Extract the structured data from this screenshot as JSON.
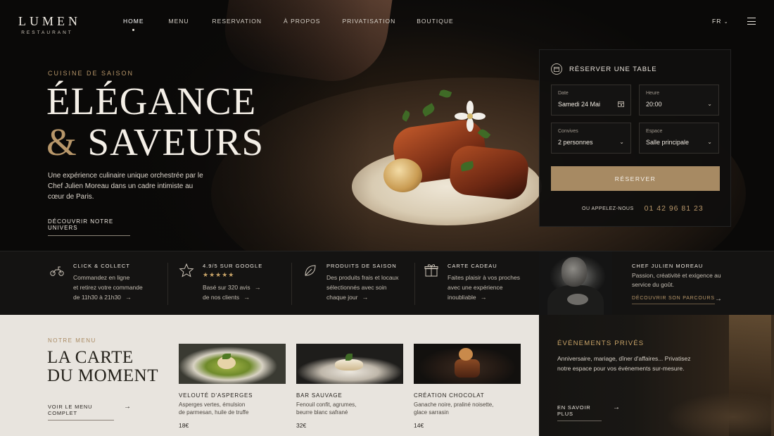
{
  "brand": {
    "name": "LUMEN",
    "tagline": "RESTAURANT"
  },
  "nav": {
    "items": [
      {
        "label": "HOME"
      },
      {
        "label": "MENU"
      },
      {
        "label": "RESERVATION"
      },
      {
        "label": "À PROPOS"
      },
      {
        "label": "PRIVATISATION"
      },
      {
        "label": "BOUTIQUE"
      }
    ],
    "active_index": 0,
    "lang": "FR"
  },
  "hero": {
    "kicker": "CUISINE DE SAISON",
    "title_line1": "ÉLÉGANCE",
    "title_amp": "&",
    "title_line2": "SAVEURS",
    "lead": "Une expérience culinaire unique orchestrée par le Chef Julien Moreau dans un cadre intimiste au cœur de Paris.",
    "cta": "DÉCOUVRIR NOTRE UNIVERS"
  },
  "reservation": {
    "title": "RÉSERVER UNE TABLE",
    "date": {
      "label": "Date",
      "value": "Samedi 24 Mai"
    },
    "time": {
      "label": "Heure",
      "value": "20:00"
    },
    "guests": {
      "label": "Convives",
      "value": "2 personnes"
    },
    "space": {
      "label": "Espace",
      "value": "Salle principale"
    },
    "button": "RÉSERVER",
    "call_label": "OU APPELEZ-NOUS",
    "phone": "01 42 96 81 23"
  },
  "features": [
    {
      "icon": "scooter-icon",
      "title": "CLICK & COLLECT",
      "lines": [
        "Commandez en ligne",
        "et retirez votre commande",
        "de 11h30 à 21h30"
      ]
    },
    {
      "icon": "star-icon",
      "title": "4.9/5 SUR GOOGLE",
      "stars": "★★★★★",
      "lines": [
        "Basé sur 320 avis",
        "de nos clients"
      ]
    },
    {
      "icon": "leaf-icon",
      "title": "PRODUITS DE SAISON",
      "lines": [
        "Des produits frais et locaux",
        "sélectionnés avec soin",
        "chaque jour"
      ]
    },
    {
      "icon": "gift-icon",
      "title": "CARTE CADEAU",
      "lines": [
        "Faites plaisir à vos proches",
        "avec une expérience",
        "inoubliable"
      ]
    }
  ],
  "chef": {
    "title": "CHEF JULIEN MOREAU",
    "desc": "Passion, créativité et exigence au service du goût.",
    "link": "DÉCOUVRIR SON PARCOURS"
  },
  "menu": {
    "kicker": "NOTRE MENU",
    "title_line1": "LA CARTE",
    "title_line2": "DU MOMENT",
    "link": "VOIR LE MENU COMPLET",
    "dishes": [
      {
        "name": "VELOUTÉ D'ASPERGES",
        "desc1": "Asperges vertes, émulsion",
        "desc2": "de parmesan, huile de truffe",
        "price": "18€"
      },
      {
        "name": "BAR SAUVAGE",
        "desc1": "Fenouil confit, agrumes,",
        "desc2": "beurre blanc safrané",
        "price": "32€"
      },
      {
        "name": "CRÉATION CHOCOLAT",
        "desc1": "Ganache noire, praliné noisette,",
        "desc2": "glace sarrasin",
        "price": "14€"
      }
    ]
  },
  "events": {
    "title": "ÉVÉNEMENTS PRIVÉS",
    "desc": "Anniversaire, mariage, dîner d'affaires... Privatisez notre espace pour vos événements sur-mesure.",
    "link": "EN SAVOIR PLUS"
  },
  "colors": {
    "gold": "#b8976a",
    "button": "#a78a63",
    "dark": "#141312",
    "cream": "#e8e4de"
  }
}
